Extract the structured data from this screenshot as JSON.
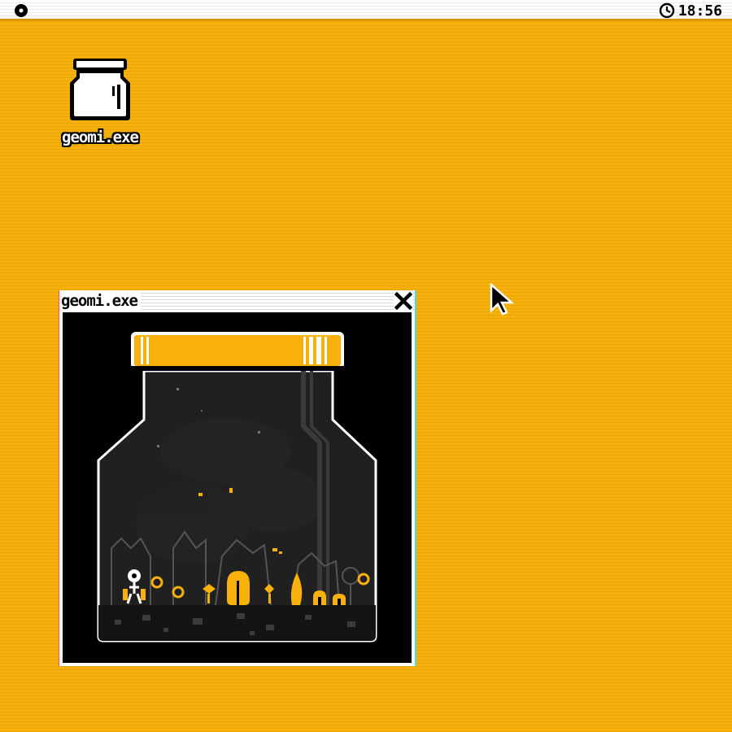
{
  "menubar": {
    "logo_icon": "circle-logo-icon",
    "clock_icon": "clock-icon",
    "time": "18:56"
  },
  "desktop": {
    "background_color": "#f7b10a",
    "icons": [
      {
        "label": "geomi.exe",
        "icon": "jar-icon"
      }
    ]
  },
  "window": {
    "title": "geomi.exe",
    "close_icon": "close-icon",
    "game": {
      "scene": "terrarium-jar",
      "accent_color": "#f7b10a",
      "background_color": "#000000"
    }
  },
  "cursor": {
    "icon": "arrow-cursor-icon"
  }
}
